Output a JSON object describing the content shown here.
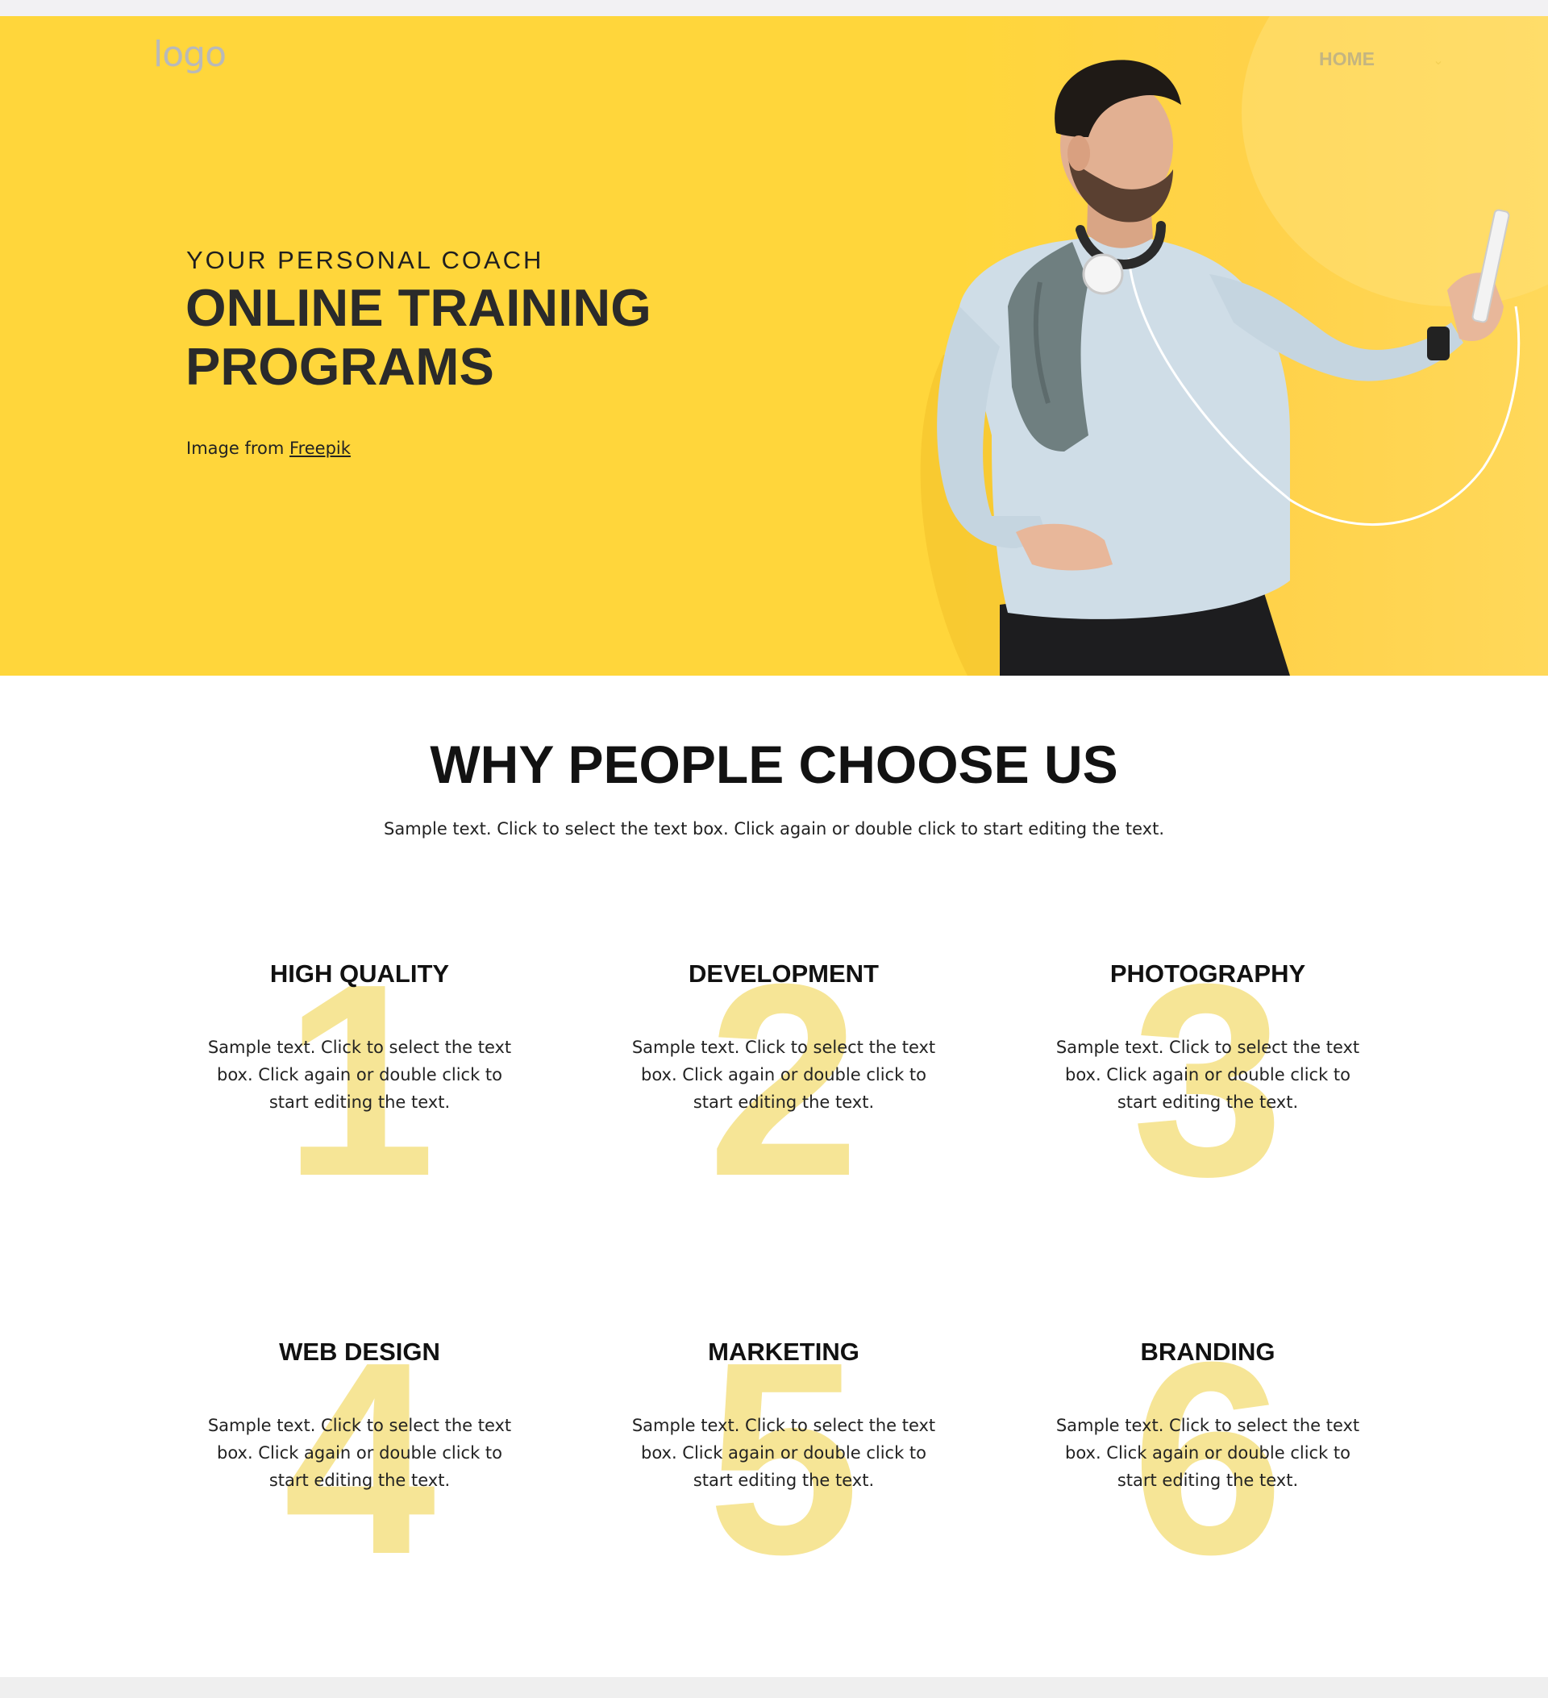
{
  "header": {
    "logo_text": "logo",
    "nav_home": "HOME",
    "nav_toggle_icon": "chevron-down-icon"
  },
  "hero": {
    "subtitle": "YOUR PERSONAL COACH",
    "title": "ONLINE TRAINING PROGRAMS",
    "credit_prefix": "Image from",
    "credit_link": "Freepik",
    "background_color": "#ffd63b"
  },
  "why": {
    "title": "WHY PEOPLE CHOOSE US",
    "text": "Sample text. Click to select the text box. Click again or double click to start editing the text."
  },
  "features": [
    {
      "number": "1",
      "title": "HIGH QUALITY",
      "text": "Sample text. Click to select the text box. Click again or double click to start editing the text."
    },
    {
      "number": "2",
      "title": "DEVELOPMENT",
      "text": "Sample text. Click to select the text box. Click again or double click to start editing the text."
    },
    {
      "number": "3",
      "title": "PHOTOGRAPHY",
      "text": "Sample text. Click to select the text box. Click again or double click to start editing the text."
    },
    {
      "number": "4",
      "title": "WEB DESIGN",
      "text": "Sample text. Click to select the text box. Click again or double click to start editing the text."
    },
    {
      "number": "5",
      "title": "MARKETING",
      "text": "Sample text. Click to select the text box. Click again or double click to start editing the text."
    },
    {
      "number": "6",
      "title": "BRANDING",
      "text": "Sample text. Click to select the text box. Click again or double click to start editing the text."
    }
  ],
  "colors": {
    "accent_yellow": "#ffd63b",
    "number_yellow": "#f6e596",
    "heading": "#121212"
  }
}
